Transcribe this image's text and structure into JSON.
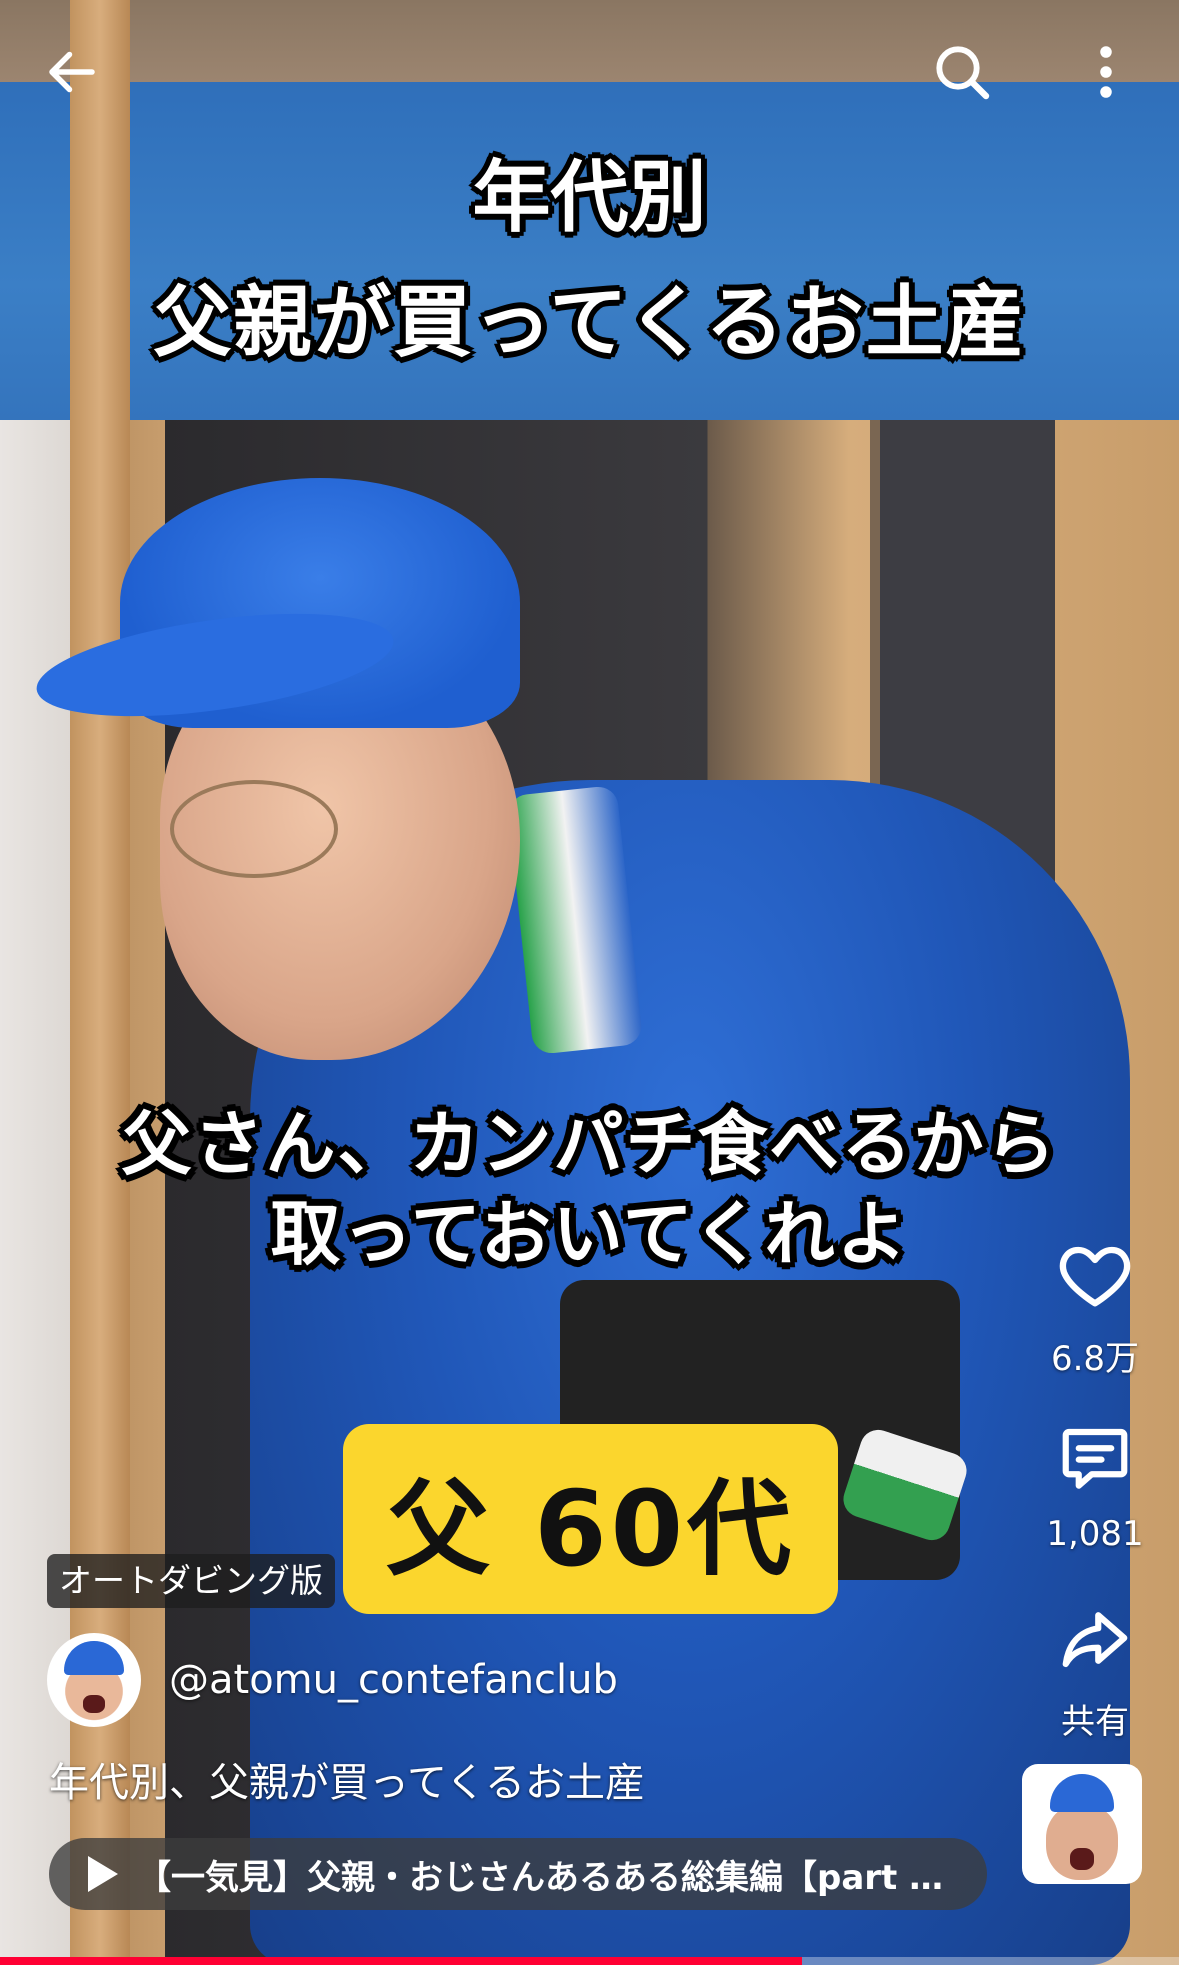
{
  "overlay": {
    "title_line1": "年代別",
    "title_line2": "父親が買ってくるお土産",
    "subtitle_line1": "父さん、カンパチ食べるから",
    "subtitle_line2": "取っておいてくれよ",
    "age_badge": "父 60代"
  },
  "top_bar": {
    "back_icon": "arrow-left-icon",
    "search_icon": "search-icon",
    "more_icon": "more-vertical-icon"
  },
  "actions": {
    "like_count": "6.8万",
    "comment_count": "1,081",
    "share_label": "共有"
  },
  "video": {
    "dubbing_badge": "オートダビング版",
    "channel_handle": "@atomu_contefanclub",
    "title": "年代別、父親が買ってくるお土産",
    "playlist_label": "【一気見】父親・おじさんあるある総集編【part 1..."
  },
  "playback": {
    "progress_fraction": 0.68
  },
  "colors": {
    "badge_yellow": "#fbd62d",
    "progress_red": "#ff0033"
  }
}
